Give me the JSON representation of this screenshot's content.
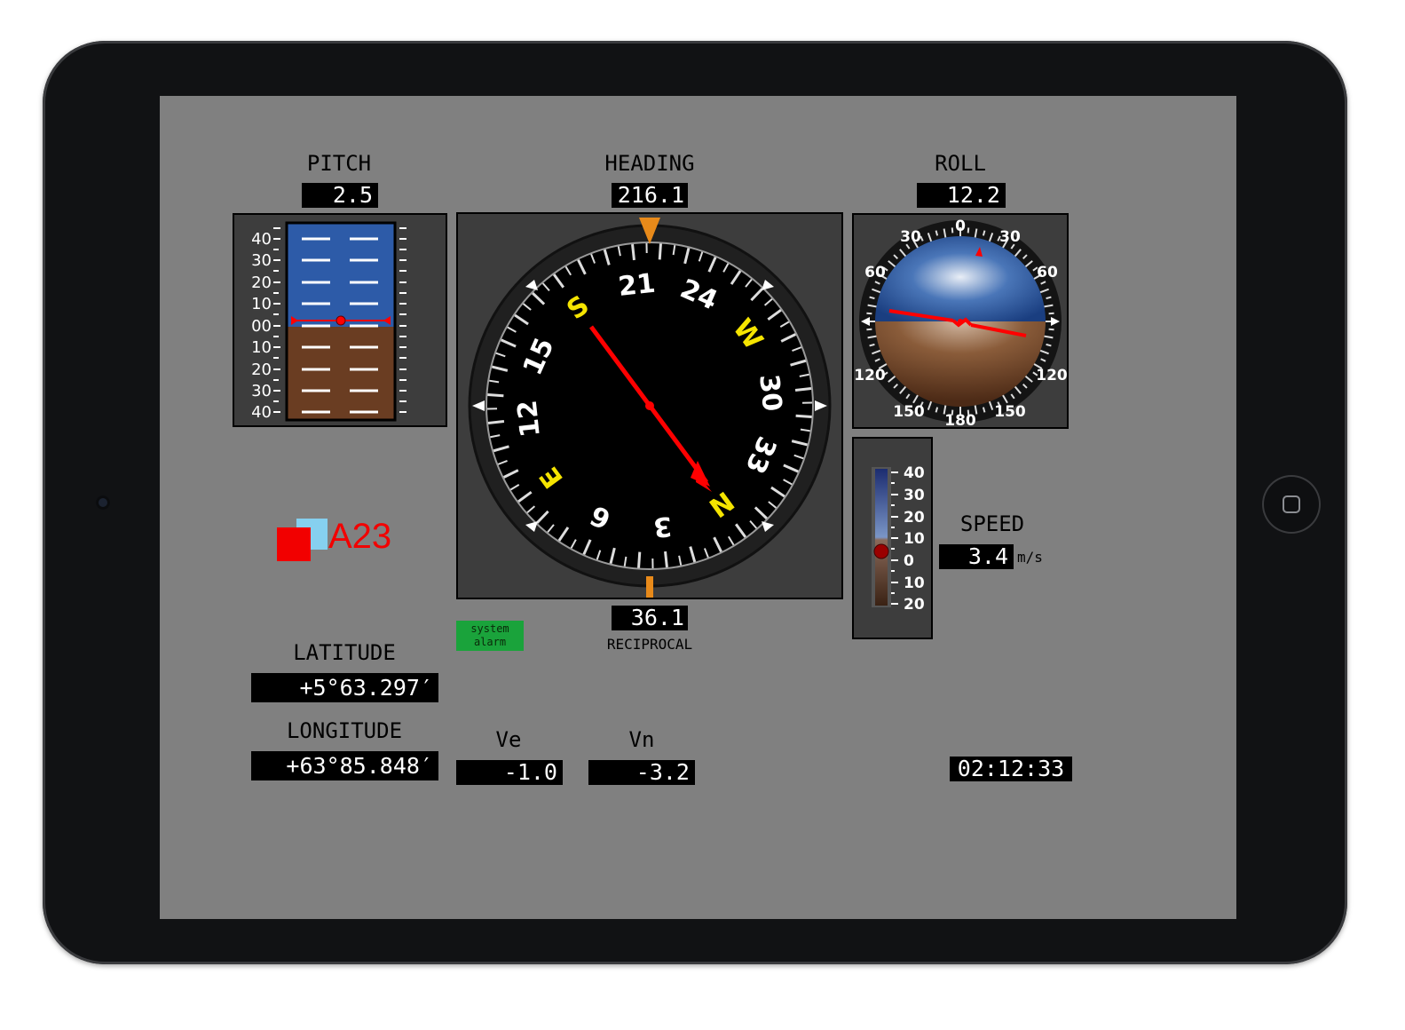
{
  "pitch": {
    "label": "PITCH",
    "value": "2.5",
    "scale_up": [
      "40",
      "30",
      "20",
      "10",
      "00"
    ],
    "scale_down": [
      "10",
      "20",
      "30",
      "40"
    ]
  },
  "heading": {
    "label": "HEADING",
    "value": "216.1",
    "reciprocal_value": "36.1",
    "reciprocal_label": "RECIPROCAL",
    "dial": [
      "N",
      "3",
      "6",
      "E",
      "12",
      "15",
      "S",
      "21",
      "24",
      "W",
      "30",
      "33"
    ]
  },
  "roll": {
    "label": "ROLL",
    "value": "12.2",
    "dial": [
      "0",
      "30",
      "60",
      "120",
      "150",
      "180",
      "150",
      "120",
      "60",
      "30"
    ]
  },
  "speed": {
    "label": "SPEED",
    "value": "3.4",
    "unit": "m/s",
    "scale": [
      "40",
      "30",
      "20",
      "10",
      "0",
      "10",
      "20"
    ]
  },
  "logo": {
    "text": "A23"
  },
  "alarm": {
    "line1": "system",
    "line2": "alarm"
  },
  "latitude": {
    "label": "LATITUDE",
    "value": "+5°63.297′"
  },
  "longitude": {
    "label": "LONGITUDE",
    "value": "+63°85.848′"
  },
  "ve": {
    "label": "Ve",
    "value": "-1.0"
  },
  "vn": {
    "label": "Vn",
    "value": "-3.2"
  },
  "clock": {
    "value": "02:12:33"
  },
  "colors": {
    "screen_bg": "#808080",
    "panel_bg": "#3d3d3d",
    "sky": "#2d5ba8",
    "ground": "#6a3d22",
    "needle": "#ff0000",
    "cardinal": "#f5e400",
    "lubber": "#e88a1a",
    "alarm": "#1aa33b"
  }
}
